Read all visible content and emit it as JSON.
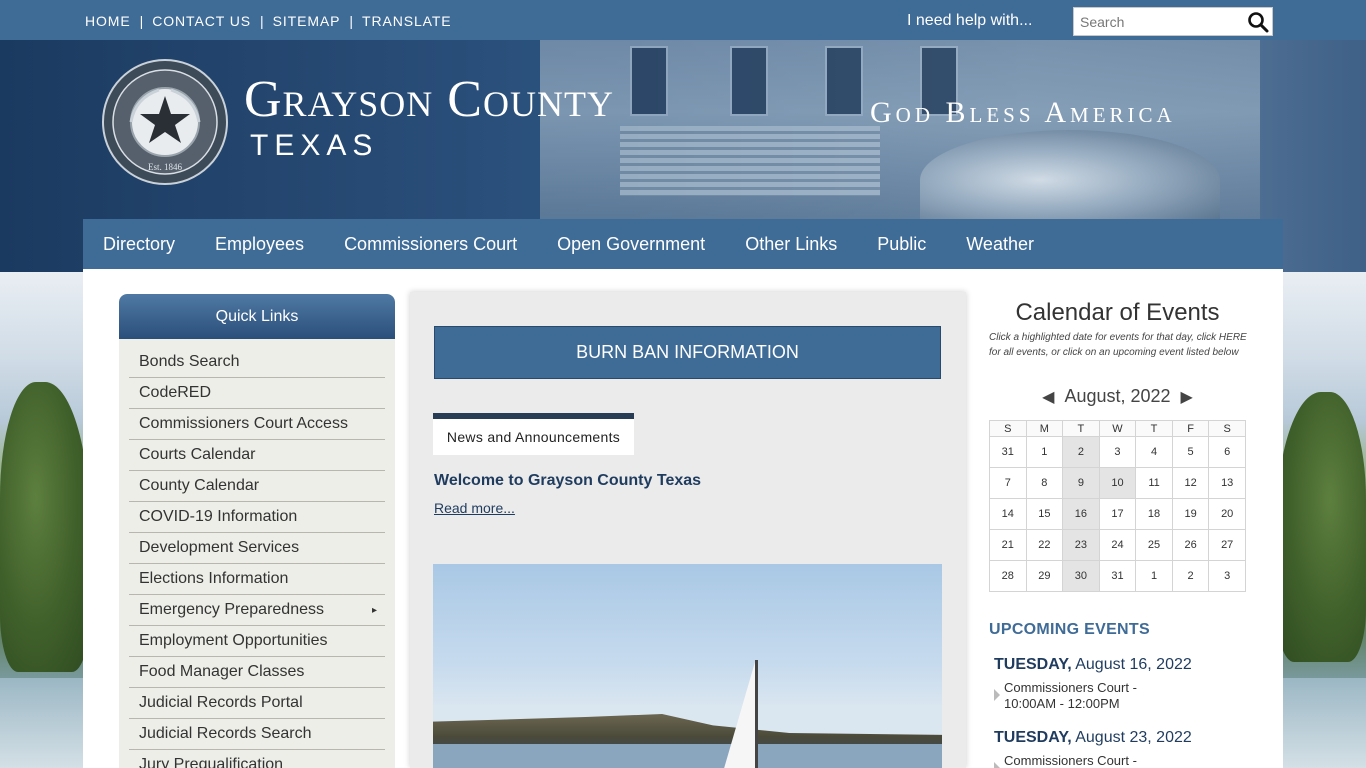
{
  "toplinks": [
    {
      "label": "HOME"
    },
    {
      "label": "CONTACT US"
    },
    {
      "label": "SITEMAP"
    },
    {
      "label": "TRANSLATE"
    }
  ],
  "help": {
    "label": "I need help with..."
  },
  "search": {
    "placeholder": "Search"
  },
  "header": {
    "seal_text": "GRAYSON COUNTY TEXAS · Est. 1846",
    "title": "Grayson County",
    "subtitle": "TEXAS",
    "motto": "God Bless America"
  },
  "nav": [
    {
      "label": "Directory"
    },
    {
      "label": "Employees"
    },
    {
      "label": "Commissioners Court"
    },
    {
      "label": "Open Government"
    },
    {
      "label": "Other Links"
    },
    {
      "label": "Public"
    },
    {
      "label": "Weather"
    }
  ],
  "quicklinks": {
    "title": "Quick Links",
    "items": [
      {
        "label": "Bonds Search"
      },
      {
        "label": "CodeRED"
      },
      {
        "label": "Commissioners Court Access"
      },
      {
        "label": "Courts Calendar"
      },
      {
        "label": "County Calendar"
      },
      {
        "label": "COVID-19 Information"
      },
      {
        "label": "Development Services"
      },
      {
        "label": "Elections Information"
      },
      {
        "label": "Emergency Preparedness",
        "submenu": "▸"
      },
      {
        "label": "Employment Opportunities"
      },
      {
        "label": "Food Manager Classes"
      },
      {
        "label": "Judicial Records Portal"
      },
      {
        "label": "Judicial Records Search"
      },
      {
        "label": "Jury Prequalification"
      }
    ]
  },
  "center": {
    "burn_ban": "BURN BAN INFORMATION",
    "news_tab": "News and Announcements",
    "news_title": "Welcome to Grayson County Texas",
    "read_more": "Read more..."
  },
  "calendar": {
    "title": "Calendar of Events",
    "note": "Click a highlighted date for events for that day, click HERE for all events, or click on an upcoming event listed below",
    "prev": "◀",
    "next": "▶",
    "month": "August, 2022",
    "weekdays": [
      "S",
      "M",
      "T",
      "W",
      "T",
      "F",
      "S"
    ],
    "weeks": [
      [
        {
          "d": "31"
        },
        {
          "d": "1"
        },
        {
          "d": "2",
          "hl": true
        },
        {
          "d": "3"
        },
        {
          "d": "4"
        },
        {
          "d": "5"
        },
        {
          "d": "6"
        }
      ],
      [
        {
          "d": "7"
        },
        {
          "d": "8"
        },
        {
          "d": "9",
          "hl": true
        },
        {
          "d": "10",
          "hl": true
        },
        {
          "d": "11"
        },
        {
          "d": "12"
        },
        {
          "d": "13"
        }
      ],
      [
        {
          "d": "14"
        },
        {
          "d": "15"
        },
        {
          "d": "16",
          "hl": true
        },
        {
          "d": "17"
        },
        {
          "d": "18"
        },
        {
          "d": "19"
        },
        {
          "d": "20"
        }
      ],
      [
        {
          "d": "21"
        },
        {
          "d": "22"
        },
        {
          "d": "23",
          "hl": true
        },
        {
          "d": "24"
        },
        {
          "d": "25"
        },
        {
          "d": "26"
        },
        {
          "d": "27"
        }
      ],
      [
        {
          "d": "28"
        },
        {
          "d": "29"
        },
        {
          "d": "30",
          "hl": true
        },
        {
          "d": "31"
        },
        {
          "d": "1"
        },
        {
          "d": "2"
        },
        {
          "d": "3"
        }
      ]
    ]
  },
  "upcoming": {
    "heading": "UPCOMING EVENTS",
    "events": [
      {
        "day": "TUESDAY,",
        "date": "August 16, 2022",
        "title": "Commissioners Court -",
        "time": "10:00AM - 12:00PM"
      },
      {
        "day": "TUESDAY,",
        "date": "August 23, 2022",
        "title": "Commissioners Court -",
        "time": ""
      }
    ]
  }
}
